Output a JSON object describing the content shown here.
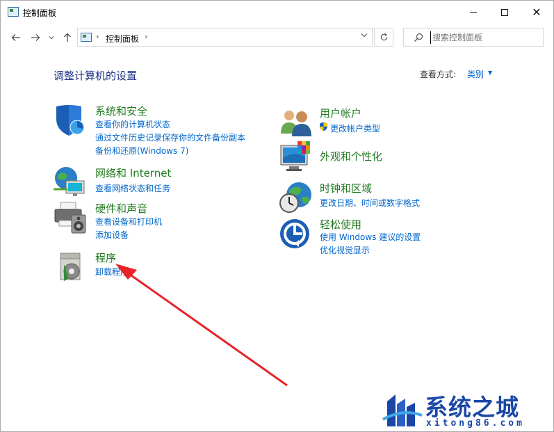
{
  "window": {
    "title": "控制面板",
    "controls": {
      "minimize": "minimize",
      "maximize": "maximize",
      "close": "✕"
    }
  },
  "address_bar": {
    "path": "控制面板",
    "separator": "›",
    "search_placeholder": "搜索控制面板"
  },
  "header": {
    "heading": "调整计算机的设置",
    "view_by_label": "查看方式:",
    "view_by_value": "类别"
  },
  "categories": [
    {
      "title": "系统和安全",
      "icon": "shield-icon",
      "links": [
        "查看你的计算机状态",
        "通过文件历史记录保存你的文件备份副本",
        "备份和还原(Windows 7)"
      ]
    },
    {
      "title": "网络和 Internet",
      "icon": "network-globe-icon",
      "links": [
        "查看网络状态和任务"
      ]
    },
    {
      "title": "硬件和声音",
      "icon": "printer-speaker-icon",
      "links": [
        "查看设备和打印机",
        "添加设备"
      ]
    },
    {
      "title": "程序",
      "icon": "programs-disc-icon",
      "links": [
        "卸载程序"
      ]
    },
    {
      "title": "用户帐户",
      "icon": "users-icon",
      "links": [
        "更改帐户类型"
      ]
    },
    {
      "title": "外观和个性化",
      "icon": "monitor-palette-icon",
      "links": []
    },
    {
      "title": "时钟和区域",
      "icon": "clock-globe-icon",
      "links": [
        "更改日期、时间或数字格式"
      ]
    },
    {
      "title": "轻松使用",
      "icon": "ease-of-access-icon",
      "links": [
        "使用 Windows 建议的设置",
        "优化视觉显示"
      ]
    }
  ],
  "watermark": {
    "title": "系统之城",
    "url": "xitong86.com"
  },
  "colors": {
    "category_title": "#217b21",
    "link": "#0066cc",
    "heading": "#1e3287",
    "arrow": "#e8232a"
  }
}
